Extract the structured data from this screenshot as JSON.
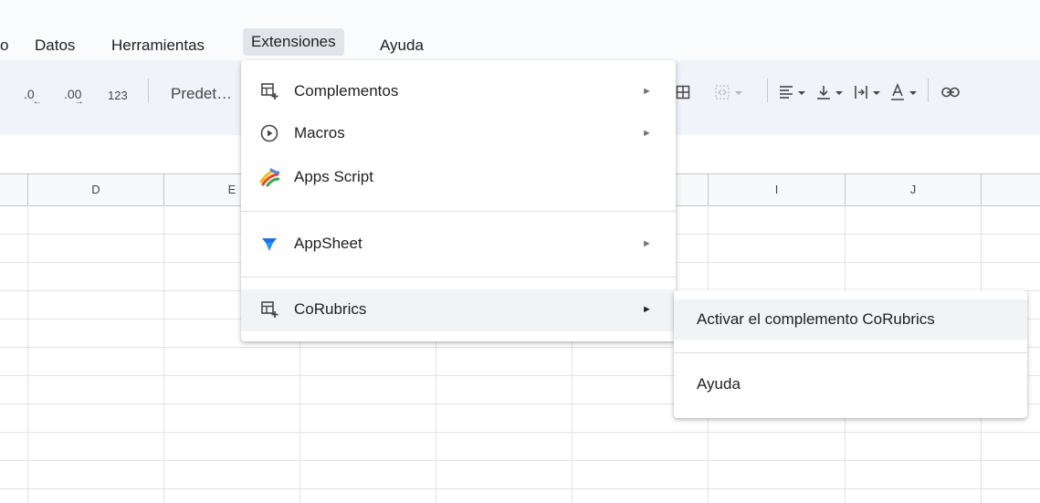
{
  "menubar": {
    "items": [
      "o",
      "Datos",
      "Herramientas",
      "Extensiones",
      "Ayuda"
    ]
  },
  "toolbar": {
    "decrease_decimals": ".0",
    "increase_decimals": ".00",
    "number_format": "123",
    "font_format": "Predet…",
    "icons": [
      "borders-icon",
      "merge-cells-icon",
      "horizontal-align-icon",
      "vertical-align-icon",
      "text-wrap-icon",
      "text-rotation-icon",
      "insert-link-icon"
    ]
  },
  "grid": {
    "columns": [
      "D",
      "E",
      "I",
      "J"
    ]
  },
  "extensions_menu": {
    "items": [
      {
        "label": "Complementos",
        "icon": "add-on-icon",
        "has_submenu": true
      },
      {
        "label": "Macros",
        "icon": "play-circle-icon",
        "has_submenu": true
      },
      {
        "label": "Apps Script",
        "icon": "apps-script-icon",
        "has_submenu": false
      },
      {
        "label": "AppSheet",
        "icon": "appsheet-icon",
        "has_submenu": true
      },
      {
        "label": "CoRubrics",
        "icon": "add-on-icon",
        "has_submenu": true
      }
    ],
    "submenu_arrow": "►"
  },
  "corubrics_submenu": {
    "items": [
      {
        "label": "Activar el complemento CoRubrics"
      },
      {
        "label": "Ayuda"
      }
    ]
  },
  "colors": {
    "accent": "#1a73e8",
    "appsheet_blue": "#2196f3",
    "highlight": "#f1f3f4"
  }
}
